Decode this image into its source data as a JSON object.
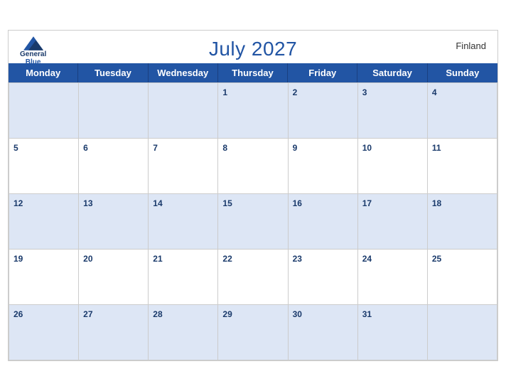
{
  "calendar": {
    "title": "July 2027",
    "country": "Finland",
    "month": "July",
    "year": "2027",
    "days_of_week": [
      "Monday",
      "Tuesday",
      "Wednesday",
      "Thursday",
      "Friday",
      "Saturday",
      "Sunday"
    ],
    "weeks": [
      [
        null,
        null,
        null,
        1,
        2,
        3,
        4
      ],
      [
        5,
        6,
        7,
        8,
        9,
        10,
        11
      ],
      [
        12,
        13,
        14,
        15,
        16,
        17,
        18
      ],
      [
        19,
        20,
        21,
        22,
        23,
        24,
        25
      ],
      [
        26,
        27,
        28,
        29,
        30,
        31,
        null
      ]
    ],
    "logo": {
      "general": "General",
      "blue": "Blue"
    }
  }
}
